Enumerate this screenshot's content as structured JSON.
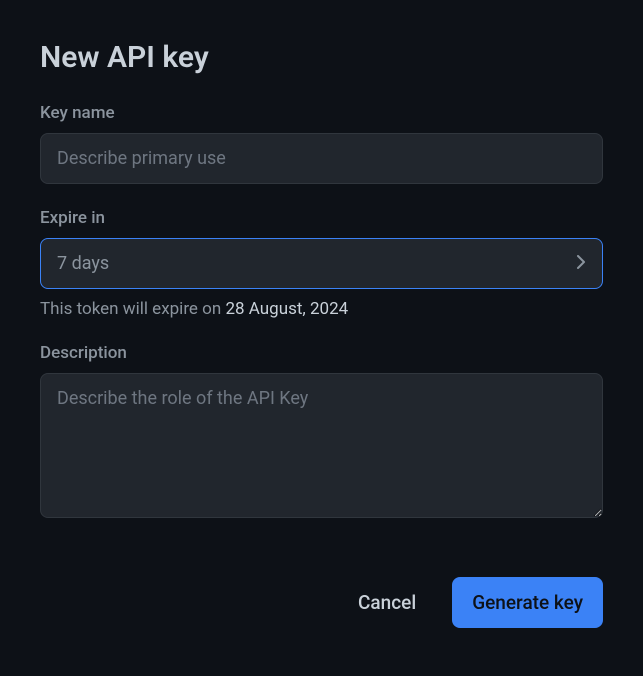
{
  "modal": {
    "title": "New API key"
  },
  "keyName": {
    "label": "Key name",
    "placeholder": "Describe primary use",
    "value": ""
  },
  "expireIn": {
    "label": "Expire in",
    "selected": "7 days",
    "notePrefix": "This token will expire on ",
    "expireDate": "28 August, 2024"
  },
  "description": {
    "label": "Description",
    "placeholder": "Describe the role of the API Key",
    "value": ""
  },
  "buttons": {
    "cancel": "Cancel",
    "generate": "Generate key"
  }
}
